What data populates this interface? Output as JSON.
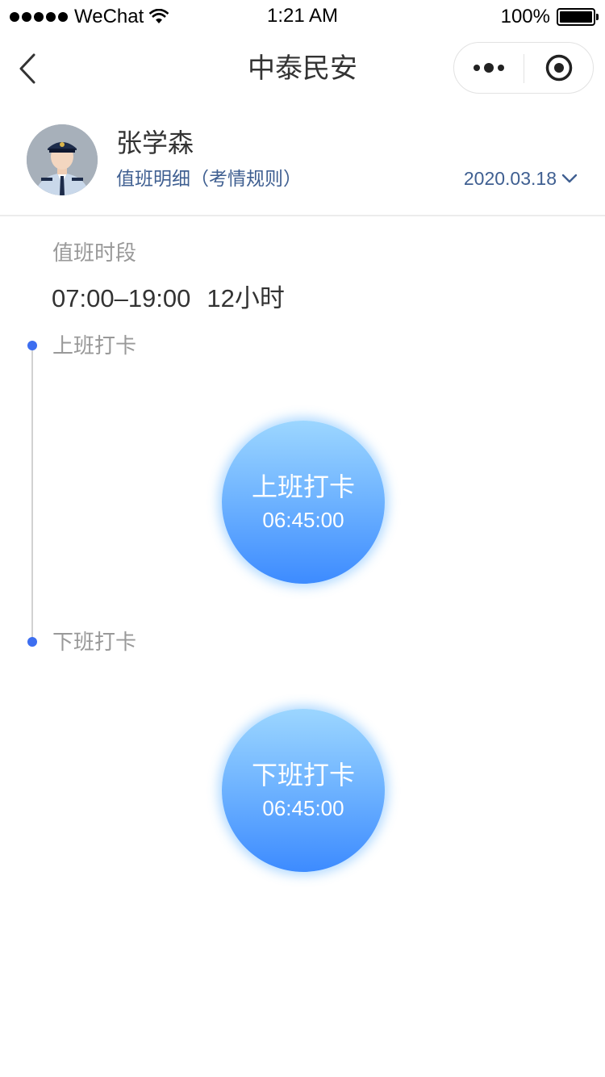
{
  "status_bar": {
    "carrier": "WeChat",
    "time": "1:21 AM",
    "battery": "100%"
  },
  "nav": {
    "title": "中泰民安",
    "back_icon": "chevron-left-icon",
    "more_icon": "more-dots-icon",
    "close_icon": "target-close-icon"
  },
  "profile": {
    "name": "张学森",
    "link": "值班明细（考情规则）",
    "date": "2020.03.18"
  },
  "shift": {
    "section_label": "值班时段",
    "time_range": "07:00–19:00",
    "duration": "12小时"
  },
  "timeline": [
    {
      "label": "上班打卡",
      "button_label": "上班打卡",
      "button_time": "06:45:00"
    },
    {
      "label": "下班打卡",
      "button_label": "下班打卡",
      "button_time": "06:45:00"
    }
  ],
  "colors": {
    "accent": "#3d6ef0",
    "link": "#3f5f91",
    "button_gradient_top": "#9cd6ff",
    "button_gradient_bottom": "#3d8bff"
  }
}
